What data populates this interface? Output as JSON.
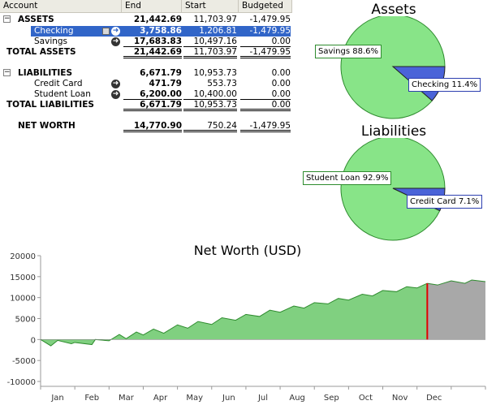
{
  "table": {
    "headers": [
      "Account",
      "End",
      "Start",
      "Budgeted"
    ],
    "assets": {
      "label": "ASSETS",
      "end": "21,442.69",
      "start": "11,703.97",
      "budgeted": "-1,479.95",
      "rows": [
        {
          "name": "Checking",
          "end": "3,758.86",
          "start": "1,206.81",
          "budgeted": "-1,479.95"
        },
        {
          "name": "Savings",
          "end": "17,683.83",
          "start": "10,497.16",
          "budgeted": "0.00"
        }
      ],
      "total_label": "TOTAL ASSETS",
      "total_end": "21,442.69",
      "total_start": "11,703.97",
      "total_budgeted": "-1,479.95"
    },
    "liabilities": {
      "label": "LIABILITIES",
      "end": "6,671.79",
      "start": "10,953.73",
      "budgeted": "0.00",
      "rows": [
        {
          "name": "Credit Card",
          "end": "471.79",
          "start": "553.73",
          "budgeted": "0.00"
        },
        {
          "name": "Student Loan",
          "end": "6,200.00",
          "start": "10,400.00",
          "budgeted": "0.00"
        }
      ],
      "total_label": "TOTAL LIABILITIES",
      "total_end": "6,671.79",
      "total_start": "10,953.73",
      "total_budgeted": "0.00"
    },
    "net_worth": {
      "label": "NET WORTH",
      "end": "14,770.90",
      "start": "750.24",
      "budgeted": "-1,479.95"
    }
  },
  "assets_pie": {
    "title": "Assets",
    "slices": [
      {
        "label": "Savings 88.6%",
        "value": 88.6,
        "color": "#88e488"
      },
      {
        "label": "Checking 11.4%",
        "value": 11.4,
        "color": "#4a63d8"
      }
    ]
  },
  "liabilities_pie": {
    "title": "Liabilities",
    "slices": [
      {
        "label": "Student Loan 92.9%",
        "value": 92.9,
        "color": "#88e488"
      },
      {
        "label": "Credit Card 7.1%",
        "value": 7.1,
        "color": "#4a63d8"
      }
    ]
  },
  "chart_data": {
    "type": "area",
    "title": "Net Worth (USD)",
    "xlabel": "",
    "ylabel": "",
    "categories": [
      "Jan",
      "Feb",
      "Mar",
      "Apr",
      "May",
      "Jun",
      "Jul",
      "Aug",
      "Sep",
      "Oct",
      "Nov",
      "Dec"
    ],
    "ylim": [
      -10000,
      20000
    ],
    "yticks": [
      -10000,
      -5000,
      0,
      5000,
      10000,
      15000,
      20000
    ],
    "ytick_labels": [
      "-10000",
      "-5000",
      "0",
      "5000",
      "10000",
      "15000",
      "20000"
    ],
    "series": [
      {
        "values": [
          {
            "month": 0.0,
            "value": 0
          },
          {
            "month": 0.3,
            "value": -1500
          },
          {
            "month": 0.5,
            "value": -200
          },
          {
            "month": 0.9,
            "value": -1000
          },
          {
            "month": 1.0,
            "value": -700
          },
          {
            "month": 1.5,
            "value": -1200
          },
          {
            "month": 1.6,
            "value": 0
          },
          {
            "month": 2.0,
            "value": -300
          },
          {
            "month": 2.3,
            "value": 1200
          },
          {
            "month": 2.5,
            "value": 200
          },
          {
            "month": 2.8,
            "value": 1800
          },
          {
            "month": 3.0,
            "value": 1100
          },
          {
            "month": 3.3,
            "value": 2500
          },
          {
            "month": 3.6,
            "value": 1500
          },
          {
            "month": 4.0,
            "value": 3500
          },
          {
            "month": 4.3,
            "value": 2700
          },
          {
            "month": 4.6,
            "value": 4300
          },
          {
            "month": 5.0,
            "value": 3600
          },
          {
            "month": 5.3,
            "value": 5200
          },
          {
            "month": 5.7,
            "value": 4600
          },
          {
            "month": 6.0,
            "value": 6000
          },
          {
            "month": 6.4,
            "value": 5500
          },
          {
            "month": 6.7,
            "value": 7000
          },
          {
            "month": 7.0,
            "value": 6500
          },
          {
            "month": 7.4,
            "value": 8000
          },
          {
            "month": 7.7,
            "value": 7500
          },
          {
            "month": 8.0,
            "value": 8800
          },
          {
            "month": 8.4,
            "value": 8500
          },
          {
            "month": 8.7,
            "value": 9800
          },
          {
            "month": 9.0,
            "value": 9400
          },
          {
            "month": 9.4,
            "value": 10800
          },
          {
            "month": 9.7,
            "value": 10400
          },
          {
            "month": 10.0,
            "value": 11700
          },
          {
            "month": 10.4,
            "value": 11400
          },
          {
            "month": 10.7,
            "value": 12600
          },
          {
            "month": 11.0,
            "value": 12300
          },
          {
            "month": 11.3,
            "value": 13400
          },
          {
            "month": 11.6,
            "value": 13000
          },
          {
            "month": 12.0,
            "value": 14000
          },
          {
            "month": 12.4,
            "value": 13400
          },
          {
            "month": 12.6,
            "value": 14200
          },
          {
            "month": 13.0,
            "value": 13800
          }
        ],
        "projection_start_month": 11.3,
        "fill_color": "#80d080",
        "projection_color": "#a8a8a8",
        "marker_color": "#e00000"
      }
    ],
    "grid": false,
    "legend": "none"
  }
}
